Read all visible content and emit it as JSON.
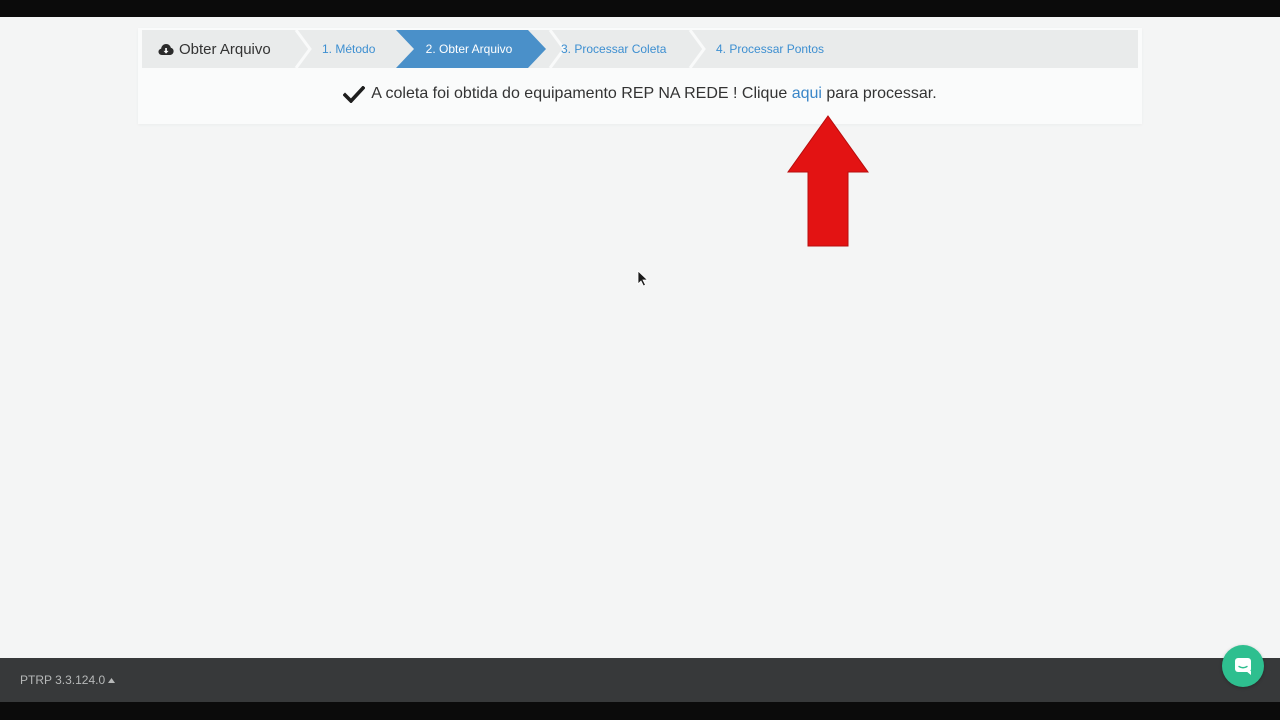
{
  "wizard": {
    "title": "Obter Arquivo",
    "steps": [
      {
        "label": "1. Método",
        "state": "inactive"
      },
      {
        "label": "2. Obter Arquivo",
        "state": "active"
      },
      {
        "label": "3. Processar Coleta",
        "state": "inactive"
      },
      {
        "label": "4. Processar Pontos",
        "state": "inactive"
      }
    ]
  },
  "message": {
    "before_link": "A coleta foi obtida do equipamento REP NA REDE ! Clique",
    "link": "aqui",
    "after_link": "para processar."
  },
  "footer": {
    "version": "PTRP 3.3.124.0"
  },
  "colors": {
    "accent": "#3d8fd1",
    "active_step": "#4a90c9",
    "annotation_arrow": "#e31313",
    "chat_button": "#2ebf8f",
    "footer_bg": "#37393a"
  },
  "icons": {
    "wizard_title": "cloud-download-icon",
    "message": "check-icon",
    "footer_toggle": "caret-up-icon",
    "chat": "chat-icon"
  }
}
